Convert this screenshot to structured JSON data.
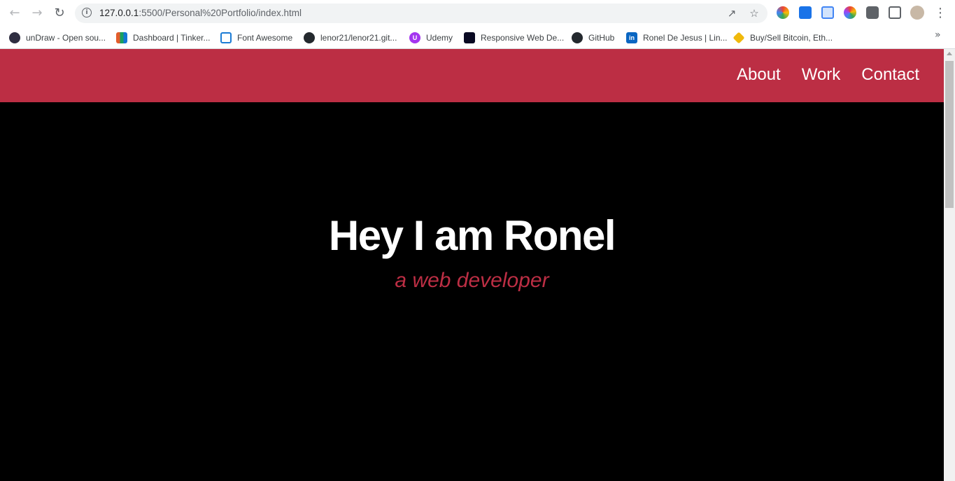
{
  "browser": {
    "url_host": "127.0.0.1",
    "url_path": ":5500/Personal%20Portfolio/index.html",
    "bookmarks": [
      {
        "label": "unDraw - Open sou...",
        "icon": "undraw-icon",
        "color": "#2f2e41"
      },
      {
        "label": "Dashboard | Tinker...",
        "icon": "tinkercad-icon",
        "color": "#e35d2b"
      },
      {
        "label": "Font Awesome",
        "icon": "flag-icon",
        "color": "#1c7cd5"
      },
      {
        "label": "lenor21/lenor21.git...",
        "icon": "github-icon",
        "color": "#24292e"
      },
      {
        "label": "Udemy",
        "icon": "udemy-icon",
        "color": "#a435f0"
      },
      {
        "label": "Responsive Web De...",
        "icon": "freecodecamp-icon",
        "color": "#0a0a23"
      },
      {
        "label": "GitHub",
        "icon": "github-icon",
        "color": "#24292e"
      },
      {
        "label": "Ronel De Jesus | Lin...",
        "icon": "linkedin-icon",
        "color": "#0a66c2"
      },
      {
        "label": "Buy/Sell Bitcoin, Eth...",
        "icon": "binance-icon",
        "color": "#f0b90b"
      }
    ]
  },
  "site": {
    "nav": [
      {
        "label": "About"
      },
      {
        "label": "Work"
      },
      {
        "label": "Contact"
      }
    ],
    "hero_title": "Hey I am Ronel",
    "hero_subtitle": "a web developer",
    "accent_color": "#bc2e44"
  }
}
